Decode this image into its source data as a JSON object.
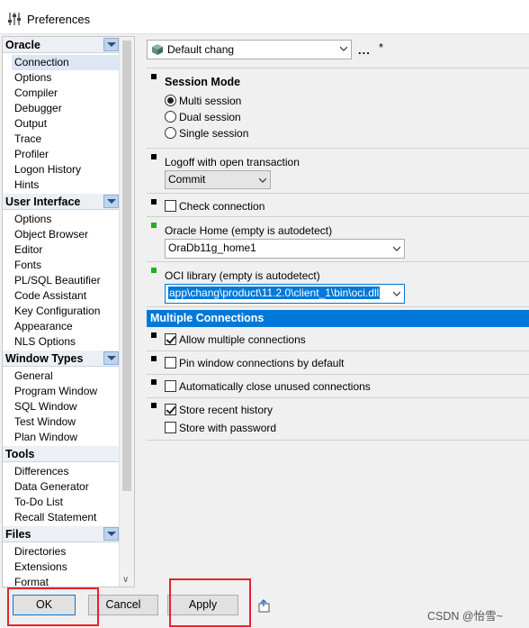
{
  "window": {
    "title": "Preferences",
    "icon": "sliders-icon"
  },
  "nav": {
    "categories": [
      {
        "label": "Oracle",
        "items": [
          "Connection",
          "Options",
          "Compiler",
          "Debugger",
          "Output",
          "Trace",
          "Profiler",
          "Logon History",
          "Hints"
        ]
      },
      {
        "label": "User Interface",
        "items": [
          "Options",
          "Object Browser",
          "Editor",
          "Fonts",
          "PL/SQL Beautifier",
          "Code Assistant",
          "Key Configuration",
          "Appearance",
          "NLS Options"
        ]
      },
      {
        "label": "Window Types",
        "items": [
          "General",
          "Program Window",
          "SQL Window",
          "Test Window",
          "Plan Window"
        ]
      },
      {
        "label": "Tools",
        "items": [
          "Differences",
          "Data Generator",
          "To-Do List",
          "Recall Statement"
        ]
      },
      {
        "label": "Files",
        "items": [
          "Directories",
          "Extensions",
          "Format"
        ]
      }
    ],
    "selected": "Connection"
  },
  "profile": {
    "value": "Default chang",
    "more_label": "...",
    "modified_marker": "*"
  },
  "session": {
    "heading": "Session Mode",
    "options": [
      "Multi session",
      "Dual session",
      "Single session"
    ],
    "selected": "Multi session"
  },
  "logoff": {
    "label": "Logoff with open transaction",
    "value": "Commit"
  },
  "check_connection": {
    "label": "Check connection",
    "checked": false
  },
  "oracle_home": {
    "label": "Oracle Home (empty is autodetect)",
    "value": "OraDb11g_home1"
  },
  "oci": {
    "label": "OCI library (empty is autodetect)",
    "value": "app\\chang\\product\\11.2.0\\client_1\\bin\\oci.dll"
  },
  "multiple_connections": {
    "heading": "Multiple Connections",
    "allow": {
      "label": "Allow multiple connections",
      "checked": true
    },
    "pin": {
      "label": "Pin window connections by default",
      "checked": false
    },
    "autoclose": {
      "label": "Automatically close unused connections",
      "checked": false
    },
    "recent": {
      "label": "Store recent history",
      "checked": true
    },
    "password": {
      "label": "Store with password",
      "checked": false
    }
  },
  "buttons": {
    "ok": "OK",
    "cancel": "Cancel",
    "apply": "Apply"
  },
  "watermark": "CSDN @怡雪~",
  "colors": {
    "selection": "#0078d7",
    "annotation": "#e8212a",
    "status_green": "#1db31d"
  }
}
